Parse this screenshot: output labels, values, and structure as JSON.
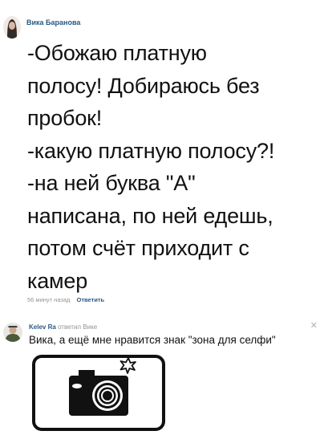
{
  "post": {
    "author_name": "Вика Баранова",
    "text_lines": [
      "-Обожаю платную",
      "полосу! Добираюсь без",
      "пробок!",
      "-какую платную полосу?!",
      "-на ней буква \"А\"",
      "написана, по ней едешь,",
      "потом счёт приходит с",
      "камер"
    ],
    "time": "56 минут назад",
    "reply_label": "Ответить"
  },
  "reply": {
    "author": "Kelev Ra",
    "action": " ответил Вике",
    "text": "Вика, а ещё мне нравится знак \"зона для селфи\"",
    "close_icon": "close-icon"
  },
  "sign_icon": "camera-selfie-sign-icon",
  "colors": {
    "link": "#2a5885",
    "meta": "#939393",
    "text": "#111111"
  }
}
